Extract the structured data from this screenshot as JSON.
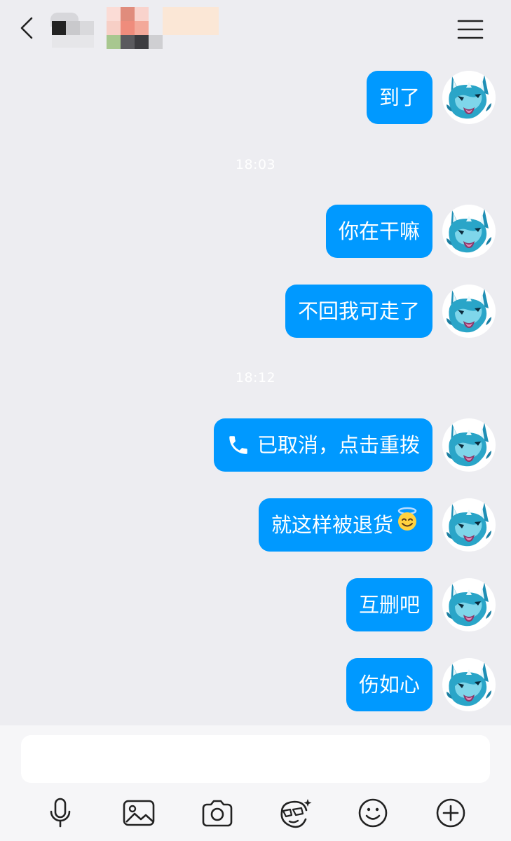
{
  "header": {
    "back_icon": "chevron-left-icon",
    "contact_name": "",
    "menu_icon": "hamburger-menu-icon"
  },
  "messages": [
    {
      "type": "bubble",
      "text": "到了"
    },
    {
      "type": "time",
      "text": "18:03"
    },
    {
      "type": "bubble",
      "text": "你在干嘛"
    },
    {
      "type": "bubble",
      "text": "不回我可走了"
    },
    {
      "type": "time",
      "text": "18:12"
    },
    {
      "type": "call",
      "icon": "phone-icon",
      "text": "已取消，点击重拨"
    },
    {
      "type": "bubble",
      "text": "就这样被退货",
      "emoji": "😇"
    },
    {
      "type": "bubble",
      "text": "互删吧"
    },
    {
      "type": "bubble",
      "text": "伤如心"
    }
  ],
  "input": {
    "placeholder": ""
  },
  "toolbar": [
    {
      "icon": "microphone-icon"
    },
    {
      "icon": "image-icon"
    },
    {
      "icon": "camera-icon"
    },
    {
      "icon": "sticker-face-icon"
    },
    {
      "icon": "emoji-icon"
    },
    {
      "icon": "plus-circle-icon"
    }
  ],
  "colors": {
    "background": "#ededf1",
    "bubble": "#0099ff",
    "bubble_text": "#ffffff",
    "timestamp": "#ffffff"
  }
}
